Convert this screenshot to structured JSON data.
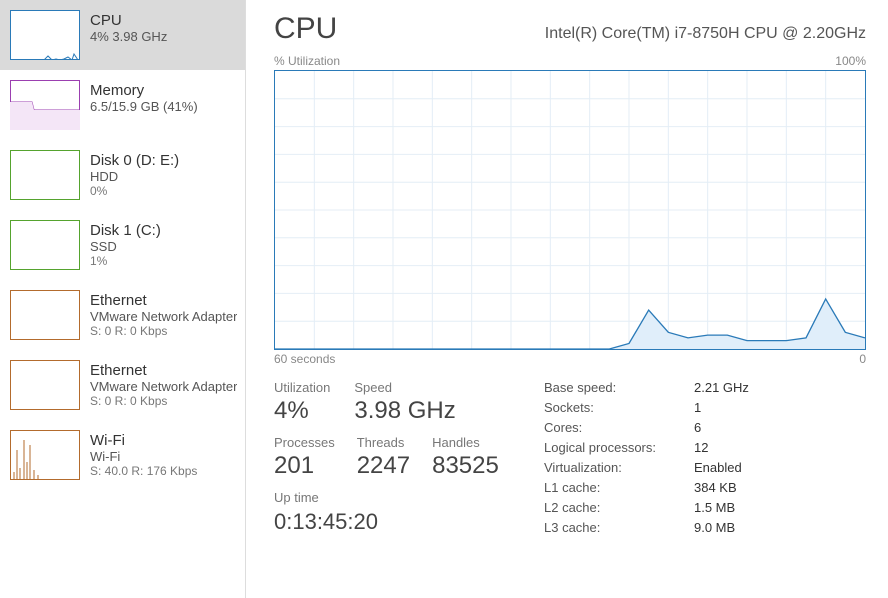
{
  "main": {
    "title": "CPU",
    "subtitle": "Intel(R) Core(TM) i7-8750H CPU @ 2.20GHz",
    "axis_top_left": "% Utilization",
    "axis_top_right": "100%",
    "axis_bottom_left": "60 seconds",
    "axis_bottom_right": "0",
    "stats": {
      "utilization_label": "Utilization",
      "utilization_value": "4%",
      "speed_label": "Speed",
      "speed_value": "3.98 GHz",
      "processes_label": "Processes",
      "processes_value": "201",
      "threads_label": "Threads",
      "threads_value": "2247",
      "handles_label": "Handles",
      "handles_value": "83525",
      "uptime_label": "Up time",
      "uptime_value": "0:13:45:20"
    },
    "info": [
      {
        "k": "Base speed:",
        "v": "2.21 GHz"
      },
      {
        "k": "Sockets:",
        "v": "1"
      },
      {
        "k": "Cores:",
        "v": "6"
      },
      {
        "k": "Logical processors:",
        "v": "12"
      },
      {
        "k": "Virtualization:",
        "v": "Enabled"
      },
      {
        "k": "L1 cache:",
        "v": "384 KB"
      },
      {
        "k": "L2 cache:",
        "v": "1.5 MB"
      },
      {
        "k": "L3 cache:",
        "v": "9.0 MB"
      }
    ]
  },
  "sidebar": [
    {
      "name": "cpu",
      "title": "CPU",
      "sub": "4%  3.98 GHz",
      "color": "#2a7ab8",
      "selected": true
    },
    {
      "name": "memory",
      "title": "Memory",
      "sub": "6.5/15.9 GB (41%)",
      "color": "#9b3fb0"
    },
    {
      "name": "disk0",
      "title": "Disk 0 (D: E:)",
      "sub": "HDD",
      "sub2": "0%",
      "color": "#55a32e"
    },
    {
      "name": "disk1",
      "title": "Disk 1 (C:)",
      "sub": "SSD",
      "sub2": "1%",
      "color": "#55a32e"
    },
    {
      "name": "eth1",
      "title": "Ethernet",
      "sub": "VMware Network Adapter",
      "sub2": "S: 0  R: 0 Kbps",
      "color": "#b36b2d"
    },
    {
      "name": "eth2",
      "title": "Ethernet",
      "sub": "VMware Network Adapter",
      "sub2": "S: 0  R: 0 Kbps",
      "color": "#b36b2d"
    },
    {
      "name": "wifi",
      "title": "Wi-Fi",
      "sub": "Wi-Fi",
      "sub2": "S: 40.0  R: 176 Kbps",
      "color": "#b36b2d"
    }
  ],
  "chart_data": {
    "type": "line",
    "title": "CPU Utilization",
    "xlabel": "seconds",
    "ylabel": "% Utilization",
    "xlim": [
      60,
      0
    ],
    "ylim": [
      0,
      100
    ],
    "x": [
      60,
      58,
      56,
      54,
      52,
      50,
      48,
      46,
      44,
      42,
      40,
      38,
      36,
      34,
      32,
      30,
      28,
      26,
      24,
      22,
      20,
      18,
      16,
      14,
      12,
      10,
      8,
      6,
      4,
      2,
      0
    ],
    "values": [
      0,
      0,
      0,
      0,
      0,
      0,
      0,
      0,
      0,
      0,
      0,
      0,
      0,
      0,
      0,
      0,
      0,
      0,
      2,
      14,
      6,
      4,
      5,
      5,
      3,
      3,
      3,
      4,
      18,
      6,
      4
    ]
  }
}
